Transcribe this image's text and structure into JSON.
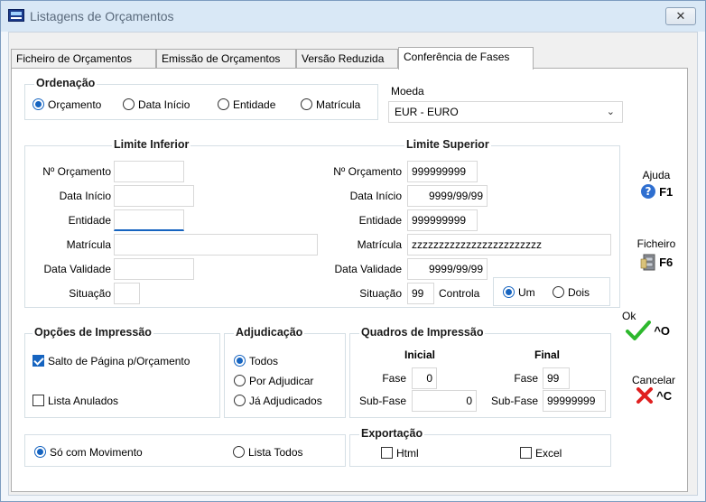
{
  "window": {
    "title": "Listagens de Orçamentos",
    "close": "✕"
  },
  "tabs": [
    "Ficheiro de Orçamentos",
    "Emissão de Orçamentos",
    "Versão Reduzida",
    "Conferência de Fases"
  ],
  "ordenacao": {
    "legend": "Ordenação",
    "options": [
      "Orçamento",
      "Data Início",
      "Entidade",
      "Matrícula"
    ],
    "selected": "Orçamento"
  },
  "moeda": {
    "label": "Moeda",
    "value": "EUR - EURO"
  },
  "limite_inferior": {
    "legend": "Limite Inferior",
    "labels": [
      "Nº Orçamento",
      "Data Início",
      "Entidade",
      "Matrícula",
      "Data Validade",
      "Situação"
    ],
    "values": [
      "",
      "",
      "",
      "",
      "",
      ""
    ]
  },
  "limite_superior": {
    "legend": "Limite Superior",
    "labels": [
      "Nº Orçamento",
      "Data Início",
      "Entidade",
      "Matrícula",
      "Data Validade",
      "Situação"
    ],
    "values": [
      "999999999",
      "9999/99/99",
      "999999999",
      "zzzzzzzzzzzzzzzzzzzzzzzz",
      "9999/99/99",
      "99"
    ],
    "controla_label": "Controla",
    "controla_options": [
      "Um",
      "Dois"
    ],
    "controla_selected": "Um"
  },
  "opcoes_impressao": {
    "legend": "Opções de Impressão",
    "salto": {
      "label": "Salto de Página p/Orçamento",
      "checked": true
    },
    "anulados": {
      "label": "Lista Anulados",
      "checked": false
    }
  },
  "adjudicacao": {
    "legend": "Adjudicação",
    "options": [
      "Todos",
      "Por Adjudicar",
      "Já Adjudicados"
    ],
    "selected": "Todos"
  },
  "quadros": {
    "legend": "Quadros de Impressão",
    "inicial": "Inicial",
    "final": "Final",
    "fase_label": "Fase",
    "subfase_label": "Sub-Fase",
    "fase_inicial": "0",
    "subfase_inicial": "0",
    "fase_final": "99",
    "subfase_final": "99999999"
  },
  "movimento": {
    "options": [
      "Só com Movimento",
      "Lista Todos"
    ],
    "selected": "Só com Movimento"
  },
  "exportacao": {
    "legend": "Exportação",
    "html": {
      "label": "Html",
      "checked": false
    },
    "excel": {
      "label": "Excel",
      "checked": false
    }
  },
  "side_buttons": {
    "ajuda": {
      "label": "Ajuda",
      "key": "F1"
    },
    "ficheiro": {
      "label": "Ficheiro",
      "key": "F6"
    },
    "ok": {
      "label": "Ok",
      "key": "^O"
    },
    "cancelar": {
      "label": "Cancelar",
      "key": "^C"
    }
  },
  "colors": {
    "accent": "#1664c0",
    "ok_green": "#2db82d",
    "cancel_red": "#e02020"
  }
}
